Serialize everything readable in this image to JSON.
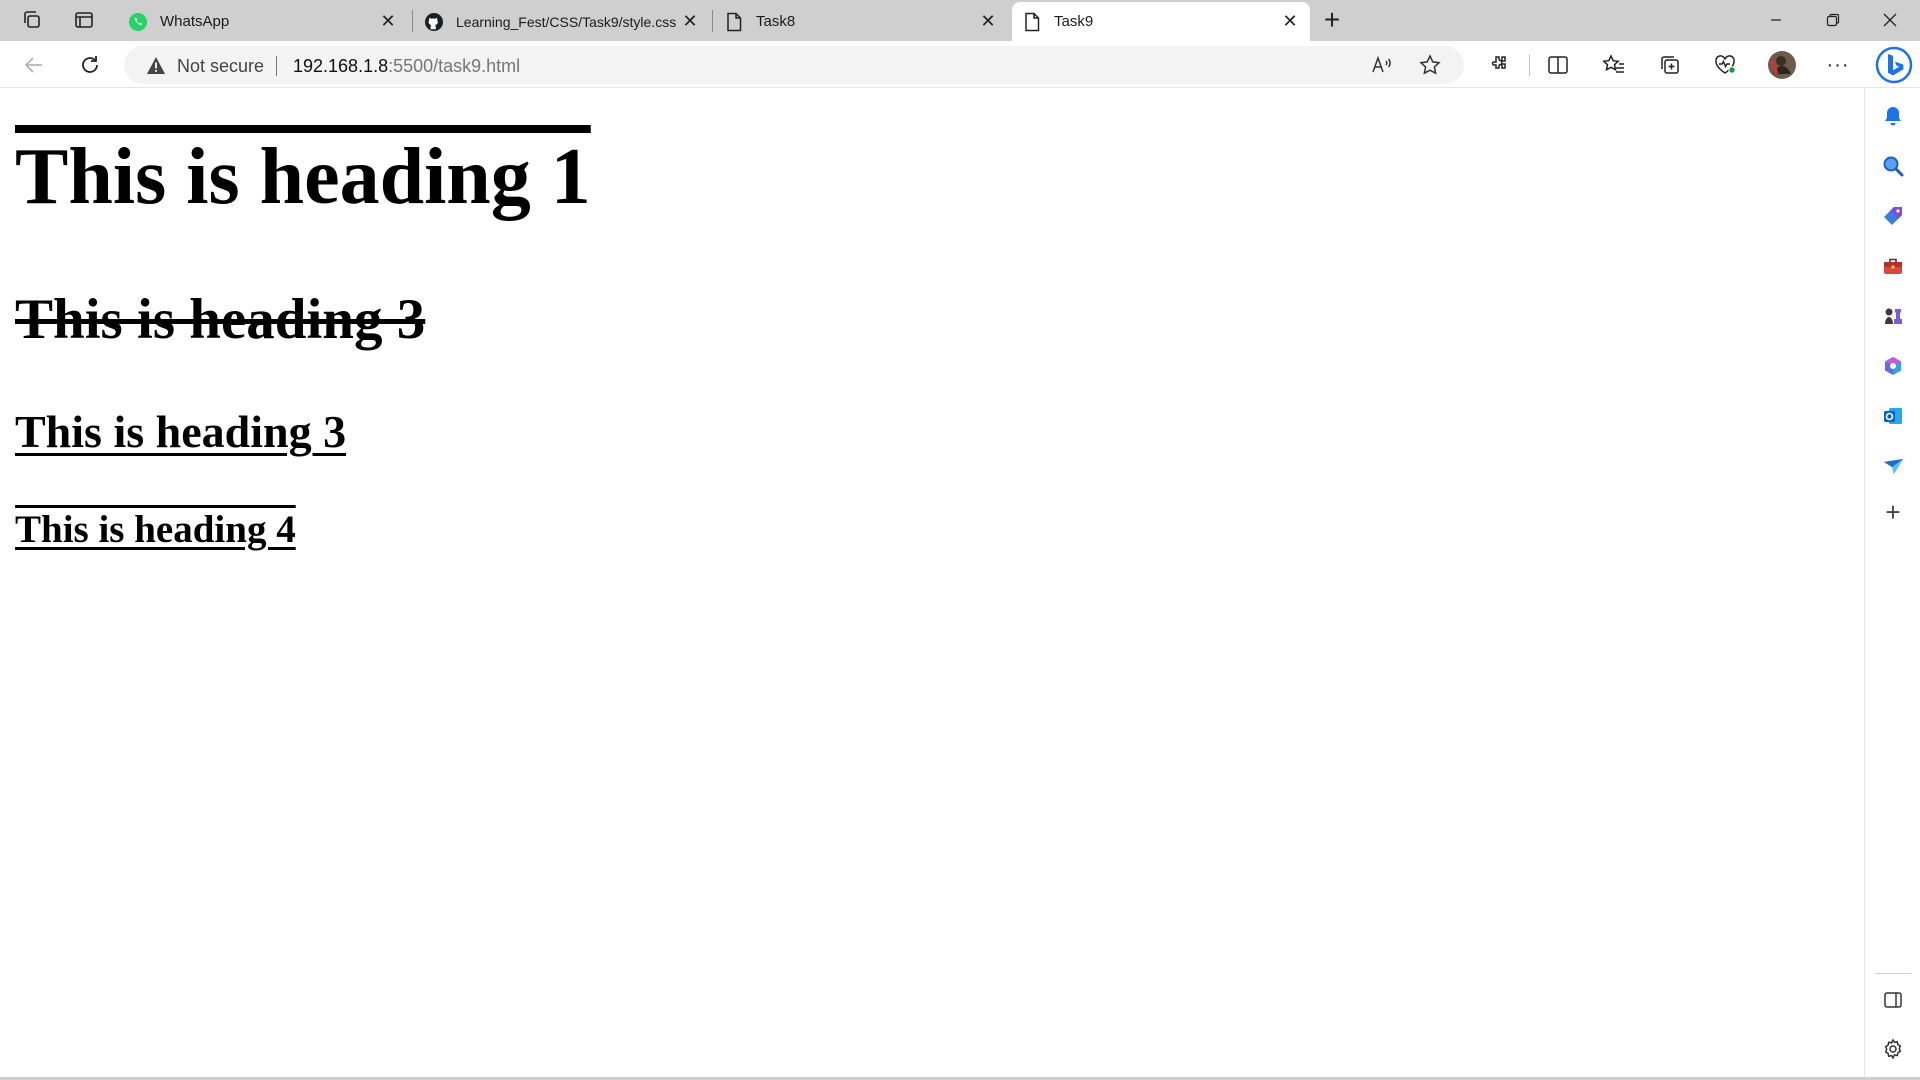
{
  "browser": {
    "tabs": [
      {
        "title": "WhatsApp",
        "icon": "whatsapp-icon"
      },
      {
        "title": "Learning_Fest/CSS/Task9/style.css",
        "icon": "github-icon"
      },
      {
        "title": "Task8",
        "icon": "page-icon"
      },
      {
        "title": "Task9",
        "icon": "page-icon",
        "active": true
      }
    ],
    "new_tab_label": "+",
    "address": {
      "security_label": "Not secure",
      "url_host": "192.168.1.8",
      "url_rest": ":5500/task9.html"
    }
  },
  "page": {
    "heading1": "This is heading 1",
    "heading3a": "This is heading 3",
    "heading3b": "This is heading 3",
    "heading4": "This is heading 4"
  },
  "colors": {
    "tabstrip_bg": "#cfcfcf",
    "bing_blue": "#1a73e8",
    "whatsapp_green": "#25d366"
  }
}
